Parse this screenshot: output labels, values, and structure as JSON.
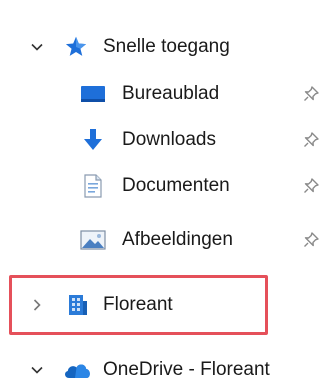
{
  "tree": {
    "quick_access": {
      "label": "Snelle toegang",
      "expanded": true
    },
    "pinned_items": [
      {
        "label": "Bureaublad",
        "icon": "desktop-icon"
      },
      {
        "label": "Downloads",
        "icon": "download-arrow-icon"
      },
      {
        "label": "Documenten",
        "icon": "document-icon"
      },
      {
        "label": "Afbeeldingen",
        "icon": "pictures-icon"
      }
    ],
    "floreant": {
      "label": "Floreant",
      "icon": "building-icon",
      "expanded": false,
      "highlighted": true
    },
    "onedrive": {
      "label": "OneDrive - Floreant",
      "icon": "cloud-icon",
      "expanded": true
    }
  },
  "colors": {
    "accent_blue": "#1e6fd9",
    "highlight_red": "#e5505a",
    "text": "#1a1a1a",
    "pin_gray": "#8a8a8a"
  }
}
